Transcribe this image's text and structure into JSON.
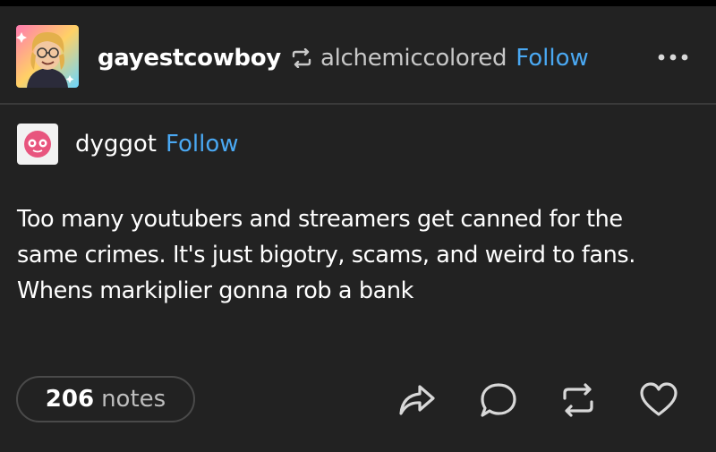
{
  "post": {
    "author": "gayestcowboy",
    "reblogged_from": "alchemiccolored",
    "follow_label": "Follow",
    "more_icon": "ellipsis-icon"
  },
  "trail": {
    "author": "dyggot",
    "follow_label": "Follow",
    "body_lines": [
      "Too many youtubers and streamers get canned for the",
      "same crimes. It's just bigotry, scams, and weird to fans.",
      "Whens markiplier gonna rob a bank"
    ]
  },
  "footer": {
    "notes_count": "206",
    "notes_label": "notes",
    "actions": [
      "share-icon",
      "reply-icon",
      "reblog-icon",
      "like-icon"
    ]
  },
  "colors": {
    "background": "#222222",
    "accent": "#4aa8f2",
    "text": "#ffffff",
    "muted": "#c8c8c8"
  }
}
